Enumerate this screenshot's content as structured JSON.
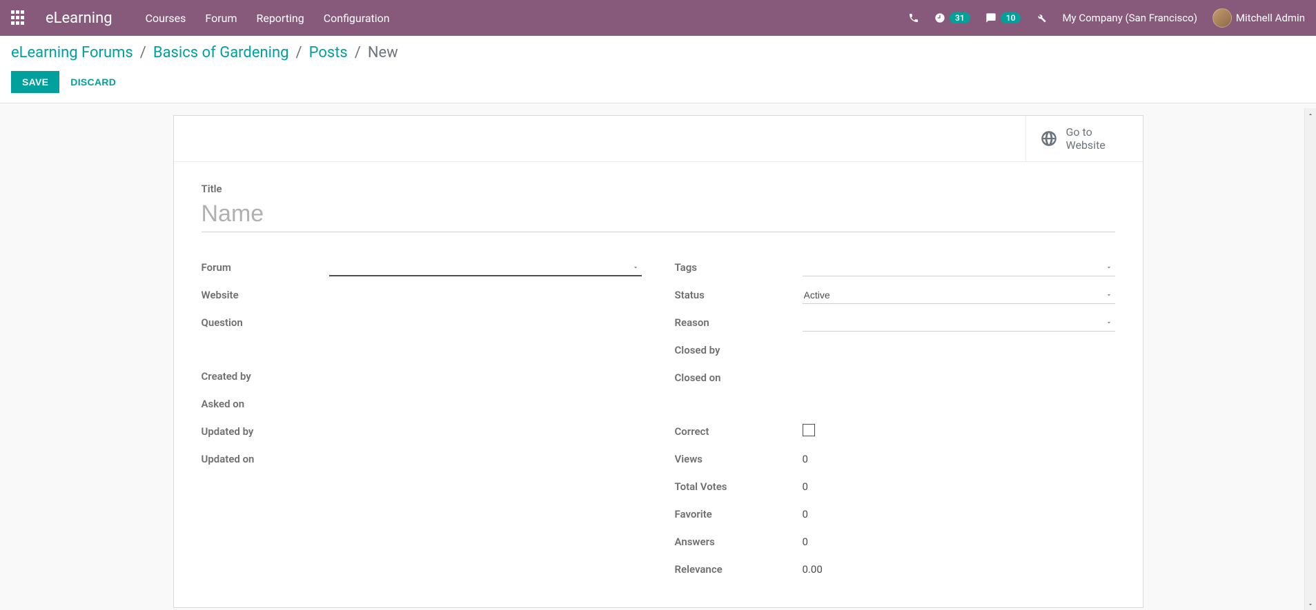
{
  "navbar": {
    "brand": "eLearning",
    "menu": [
      "Courses",
      "Forum",
      "Reporting",
      "Configuration"
    ],
    "timer_badge": "31",
    "chat_badge": "10",
    "company": "My Company (San Francisco)",
    "user": "Mitchell Admin"
  },
  "breadcrumb": {
    "items": [
      "eLearning Forums",
      "Basics of Gardening",
      "Posts"
    ],
    "current": "New"
  },
  "buttons": {
    "save": "SAVE",
    "discard": "DISCARD",
    "go_website_l1": "Go to",
    "go_website_l2": "Website"
  },
  "form": {
    "title_label": "Title",
    "title_placeholder": "Name",
    "left": {
      "forum": {
        "label": "Forum",
        "value": ""
      },
      "website": {
        "label": "Website",
        "value": ""
      },
      "question": {
        "label": "Question",
        "value": ""
      },
      "created_by": {
        "label": "Created by",
        "value": ""
      },
      "asked_on": {
        "label": "Asked on",
        "value": ""
      },
      "updated_by": {
        "label": "Updated by",
        "value": ""
      },
      "updated_on": {
        "label": "Updated on",
        "value": ""
      }
    },
    "right": {
      "tags": {
        "label": "Tags",
        "value": ""
      },
      "status": {
        "label": "Status",
        "value": "Active"
      },
      "reason": {
        "label": "Reason",
        "value": ""
      },
      "closed_by": {
        "label": "Closed by",
        "value": ""
      },
      "closed_on": {
        "label": "Closed on",
        "value": ""
      },
      "correct": {
        "label": "Correct",
        "checked": false
      },
      "views": {
        "label": "Views",
        "value": "0"
      },
      "total_votes": {
        "label": "Total Votes",
        "value": "0"
      },
      "favorite": {
        "label": "Favorite",
        "value": "0"
      },
      "answers": {
        "label": "Answers",
        "value": "0"
      },
      "relevance": {
        "label": "Relevance",
        "value": "0.00"
      }
    }
  }
}
